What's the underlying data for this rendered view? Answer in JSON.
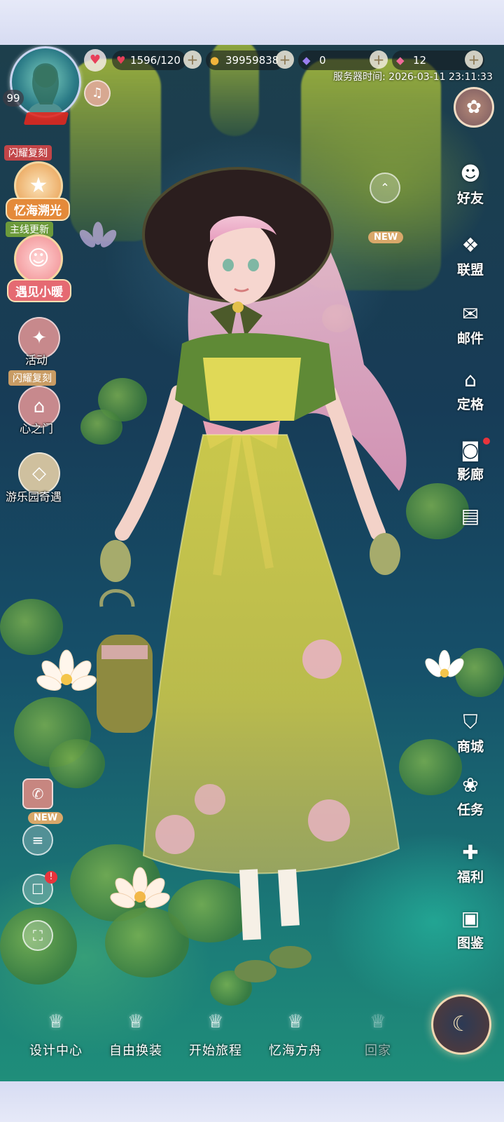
{
  "stats": {
    "stamina": "1596/120",
    "gold": "39959838",
    "diamond": "0",
    "pink_diamond": "12"
  },
  "profile": {
    "level": "99"
  },
  "server_time": "服务器时间: 2026-03-11 23:11:33",
  "left_menu": {
    "badge_shine_replica": "闪耀复刻",
    "memory_sea": "忆海溯光",
    "badge_main_update": "主线更新",
    "meet_xiaonuan": "遇见小暖",
    "activity": "活动",
    "badge_shine_replica_2": "闪耀复刻",
    "heart_gate": "心之门",
    "amusement_park": "游乐园奇遇"
  },
  "right_menu": {
    "friends": "好友",
    "alliance": "联盟",
    "mail": "邮件",
    "snapshot": "定格",
    "gallery": "影廊",
    "shop": "商城",
    "tasks": "任务",
    "welfare": "福利",
    "catalog": "图鉴"
  },
  "new_tag": "NEW",
  "bottom_nav": [
    {
      "label": "设计中心"
    },
    {
      "label": "自由换装"
    },
    {
      "label": "开始旅程"
    },
    {
      "label": "忆海方舟"
    },
    {
      "label": "回家"
    }
  ],
  "icons": {
    "heart": "heart-icon",
    "gold": "cat-coin-icon",
    "diamond": "diamond-icon",
    "pink_diamond": "pink-diamond-icon",
    "music": "music-note-icon"
  },
  "colors": {
    "red_badge": "#c24548",
    "green_badge": "#6c9a3b",
    "new_tag": "#d9a86a",
    "frame": "#dfe3f5"
  }
}
